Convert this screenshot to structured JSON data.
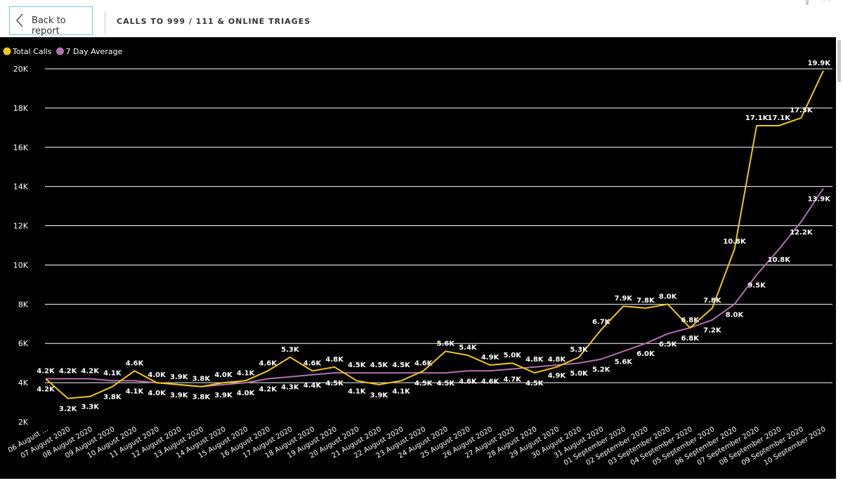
{
  "header": {
    "back_label": "Back to report",
    "title": "CALLS TO 999 / 111 & ONLINE TRIAGES",
    "more_label": "···"
  },
  "colors": {
    "total_calls": "#f2c811",
    "seven_day_avg": "#b36fb0",
    "background": "#000000",
    "grid": "#ffffff"
  },
  "chart_data": {
    "type": "line",
    "title": "",
    "xlabel": "",
    "ylabel": "",
    "ylim": [
      2000,
      20000
    ],
    "y_ticks": [
      2000,
      4000,
      6000,
      8000,
      10000,
      12000,
      14000,
      16000,
      18000,
      20000
    ],
    "y_tick_labels": [
      "2K",
      "4K",
      "6K",
      "8K",
      "10K",
      "12K",
      "14K",
      "16K",
      "18K",
      "20K"
    ],
    "grid": true,
    "legend_position": "top-left",
    "categories": [
      "06 August ...",
      "07 August 2020",
      "08 August 2020",
      "09 August 2020",
      "10 August 2020",
      "11 August 2020",
      "12 August 2020",
      "13 August 2020",
      "14 August 2020",
      "15 August 2020",
      "16 August 2020",
      "17 August 2020",
      "18 August 2020",
      "19 August 2020",
      "20 August 2020",
      "21 August 2020",
      "22 August 2020",
      "23 August 2020",
      "24 August 2020",
      "25 August 2020",
      "26 August 2020",
      "27 August 2020",
      "28 August 2020",
      "29 August 2020",
      "30 August 2020",
      "31 August 2020",
      "01 September 2020",
      "02 September 2020",
      "03 September 2020",
      "04 September 2020",
      "05 September 2020",
      "06 September 2020",
      "07 September 2020",
      "08 September 2020",
      "09 September 2020",
      "10 September 2020"
    ],
    "series": [
      {
        "name": "Total Calls",
        "values": [
          4200,
          3200,
          3300,
          3800,
          4600,
          4000,
          3900,
          3800,
          4000,
          4100,
          4600,
          5300,
          4600,
          4800,
          4100,
          3900,
          4100,
          4600,
          5600,
          5400,
          4900,
          5000,
          4500,
          4800,
          5300,
          6700,
          7900,
          7800,
          8000,
          6800,
          7800,
          10800,
          17100,
          17100,
          17500,
          19900
        ],
        "labels": [
          "4.2K",
          "3.2K",
          "3.3K",
          "3.8K",
          "4.6K",
          "4.0K",
          "3.9K",
          "3.8K",
          "4.0K",
          "4.1K",
          "4.6K",
          "5.3K",
          "4.6K",
          "4.8K",
          "4.1K",
          "3.9K",
          "4.1K",
          "4.6K",
          "5.6K",
          "5.4K",
          "4.9K",
          "5.0K",
          "4.5K",
          "4.8K",
          "5.3K",
          "6.7K",
          "7.9K",
          "7.8K",
          "8.0K",
          "6.8K",
          "7.8K",
          "10.8K",
          "17.1K",
          "17.1K",
          "17.5K",
          "19.9K"
        ]
      },
      {
        "name": "7 Day Average",
        "values": [
          4200,
          4200,
          4200,
          4100,
          4100,
          4000,
          3900,
          3800,
          3900,
          4000,
          4200,
          4300,
          4400,
          4500,
          4500,
          4500,
          4500,
          4500,
          4500,
          4600,
          4600,
          4700,
          4800,
          4900,
          5000,
          5200,
          5600,
          6000,
          6500,
          6800,
          7200,
          8000,
          9500,
          10800,
          12200,
          13900
        ],
        "labels": [
          "4.2K",
          "4.2K",
          "4.2K",
          "4.1K",
          "4.1K",
          "4.0K",
          "3.9K",
          "3.8K",
          "3.9K",
          "4.0K",
          "4.2K",
          "4.3K",
          "4.4K",
          "4.5K",
          "4.5K",
          "4.5K",
          "4.5K",
          "4.5K",
          "4.5K",
          "4.6K",
          "4.6K",
          "4.7K",
          "4.8K",
          "4.9K",
          "5.0K",
          "5.2K",
          "5.6K",
          "6.0K",
          "6.5K",
          "6.8K",
          "7.2K",
          "8.0K",
          "9.5K",
          "10.8K",
          "12.2K",
          "13.9K"
        ]
      }
    ]
  }
}
